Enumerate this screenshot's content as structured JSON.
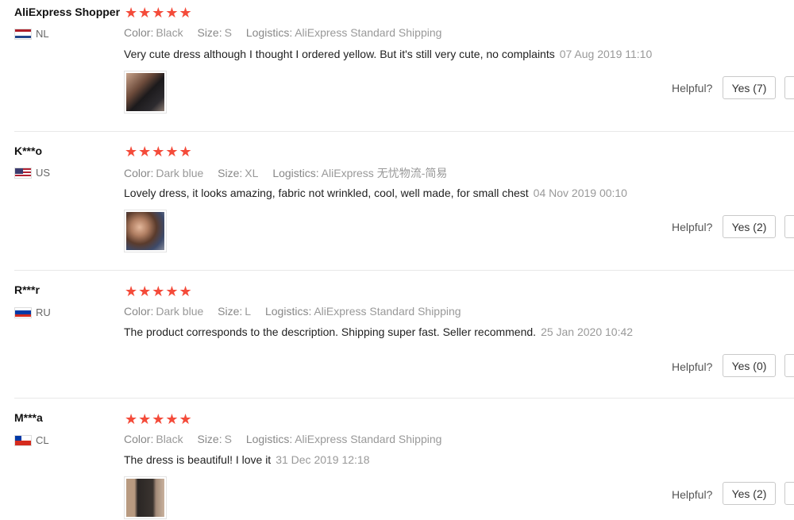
{
  "labels": {
    "color": "Color:",
    "size": "Size:",
    "logistics": "Logistics:",
    "helpful": "Helpful?"
  },
  "reviews": [
    {
      "user": "AliExpress Shopper",
      "country": "NL",
      "flag_icon": "netherlands-flag-icon",
      "rating": 5,
      "stars": "★★★★★",
      "color": "Black",
      "size": "S",
      "logistics": "AliExpress Standard Shipping",
      "text": "Very cute dress although I thought I ordered yellow. But it's still very cute, no complaints",
      "date": "07 Aug 2019 11:10",
      "has_photo": true,
      "yes_label": "Yes (7)"
    },
    {
      "user": "K***o",
      "country": "US",
      "flag_icon": "usa-flag-icon",
      "rating": 5,
      "stars": "★★★★★",
      "color": "Dark blue",
      "size": "XL",
      "logistics": "AliExpress 无忧物流-简易",
      "text": "Lovely dress, it looks amazing, fabric not wrinkled, cool, well made, for small chest",
      "date": "04 Nov 2019 00:10",
      "has_photo": true,
      "yes_label": "Yes (2)"
    },
    {
      "user": "R***r",
      "country": "RU",
      "flag_icon": "russia-flag-icon",
      "rating": 5,
      "stars": "★★★★★",
      "color": "Dark blue",
      "size": "L",
      "logistics": "AliExpress Standard Shipping",
      "text": "The product corresponds to the description. Shipping super fast. Seller recommend.",
      "date": "25 Jan 2020 10:42",
      "has_photo": false,
      "yes_label": "Yes (0)"
    },
    {
      "user": "M***a",
      "country": "CL",
      "flag_icon": "chile-flag-icon",
      "rating": 5,
      "stars": "★★★★★",
      "color": "Black",
      "size": "S",
      "logistics": "AliExpress Standard Shipping",
      "text": "The dress is beautiful! I love it",
      "date": "31 Dec 2019 12:18",
      "has_photo": true,
      "yes_label": "Yes (2)"
    }
  ],
  "colors": {
    "star": "#f44b3a",
    "muted": "#999999",
    "text": "#222222",
    "border": "#c9c9c9"
  }
}
